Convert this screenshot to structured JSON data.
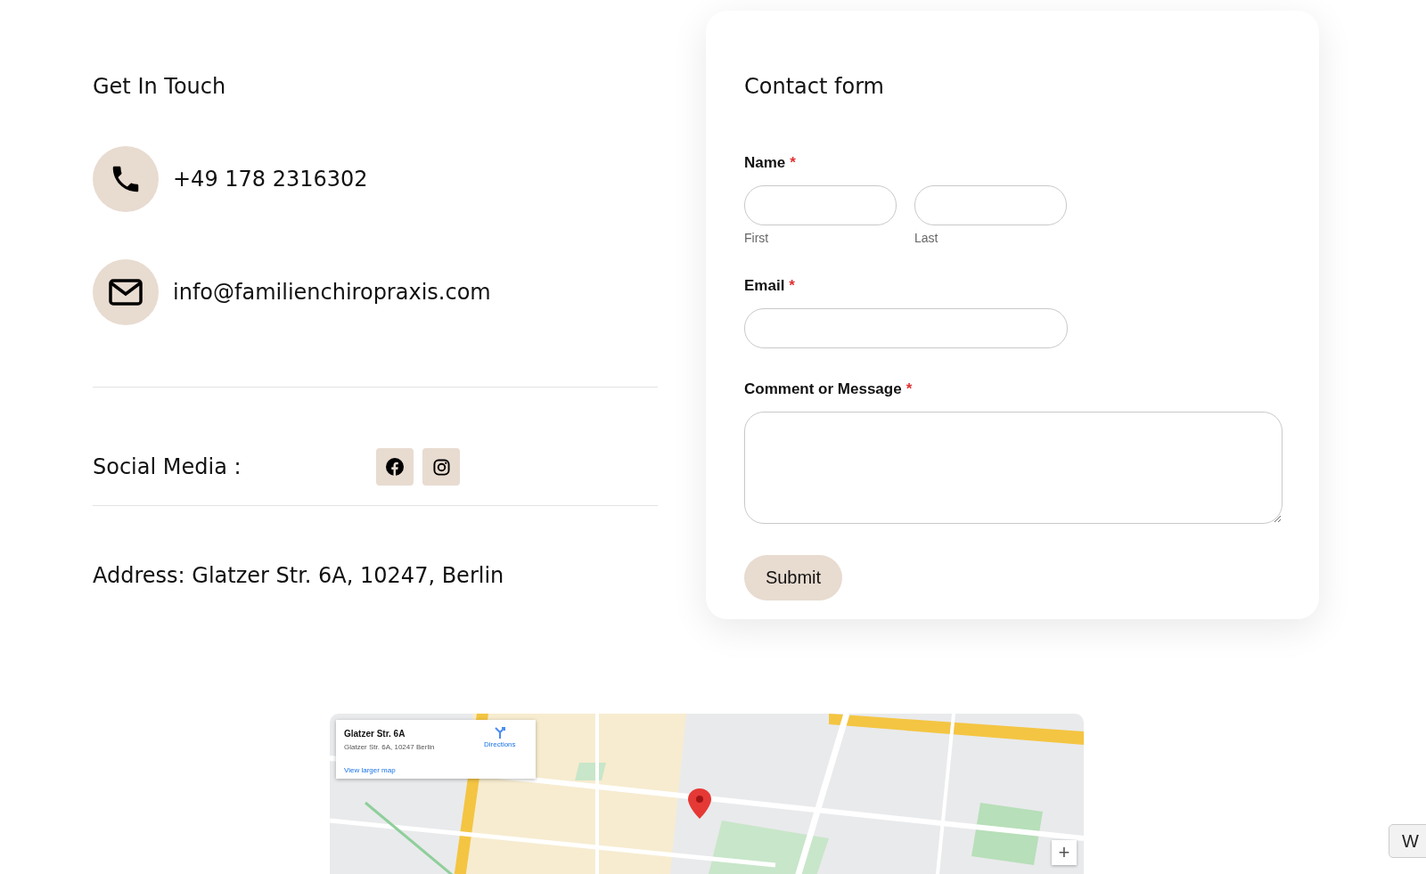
{
  "contact": {
    "heading": "Get In Touch",
    "phone": "+49 178 2316302",
    "email": "info@familienchiropraxis.com",
    "social_label": "Social Media :",
    "social_links": [
      {
        "kind": "facebook"
      },
      {
        "kind": "instagram"
      }
    ],
    "address": "Address: Glatzer Str. 6A, 10247, Berlin"
  },
  "form": {
    "title": "Contact form",
    "fields": [
      {
        "kind": "name",
        "label": "Name",
        "required_mark": "*",
        "sublabels": [
          "First",
          "Last"
        ]
      },
      {
        "kind": "email",
        "label": "Email",
        "required_mark": "*"
      },
      {
        "kind": "message",
        "label": "Comment or Message",
        "required_mark": "*"
      }
    ],
    "submit": "Submit"
  },
  "map": {
    "kind": "picture",
    "place_card": {
      "title": "Glatzer Str. 6A",
      "address": "Glatzer Str. 6A, 10247 Berlin",
      "directions": "Directions",
      "larger_map": "View larger map"
    },
    "zoom_in": "+"
  },
  "side_button": "W"
}
